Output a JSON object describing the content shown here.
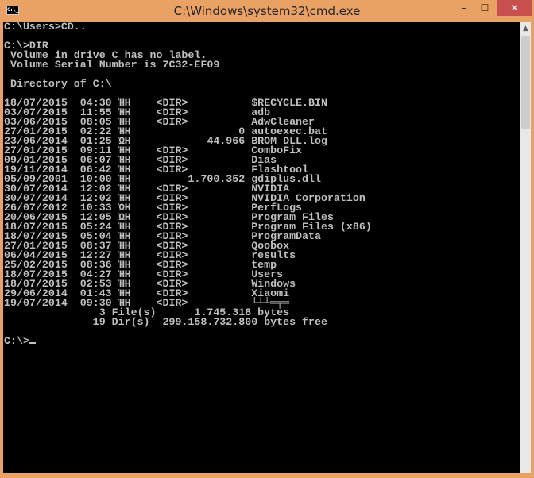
{
  "window": {
    "title": "C:\\Windows\\system32\\cmd.exe",
    "icon": "C:\\_",
    "minimize": "–",
    "maximize": "☐",
    "close": "✕"
  },
  "console": {
    "lines": [
      "C:\\Users>CD..",
      "",
      "C:\\>DIR",
      " Volume in drive C has no label.",
      " Volume Serial Number is 7C32-EF09",
      "",
      " Directory of C:\\",
      "",
      "18/07/2015  04:30 ΉΗ    <DIR>          $RECYCLE.BIN",
      "03/07/2015  11:55 ΉΗ    <DIR>          adb",
      "03/06/2015  08:05 ΉΗ    <DIR>          AdwCleaner",
      "27/01/2015  02:22 ΉΗ                 0 autoexec.bat",
      "23/06/2014  01:25 ΏΗ            44.966 BROM_DLL.log",
      "27/01/2015  09:11 ΉΗ    <DIR>          ComboFix",
      "09/01/2015  06:07 ΉΗ    <DIR>          Dias",
      "19/11/2014  06:42 ΉΗ    <DIR>          Flashtool",
      "05/09/2001  10:00 ΉΗ         1.700.352 gdiplus.dll",
      "30/07/2014  12:02 ΉΗ    <DIR>          NVIDIA",
      "30/07/2014  12:02 ΉΗ    <DIR>          NVIDIA Corporation",
      "26/07/2012  10:33 ΏΗ    <DIR>          PerfLogs",
      "20/06/2015  12:05 ΏΗ    <DIR>          Program Files",
      "18/07/2015  05:24 ΉΗ    <DIR>          Program Files (x86)",
      "18/07/2015  05:04 ΉΗ    <DIR>          ProgramData",
      "27/01/2015  08:37 ΉΗ    <DIR>          Qoobox",
      "06/04/2015  12:27 ΉΗ    <DIR>          results",
      "25/02/2015  08:36 ΉΗ    <DIR>          temp",
      "18/07/2015  04:27 ΉΗ    <DIR>          Users",
      "18/07/2015  02:53 ΉΗ    <DIR>          Windows",
      "29/06/2014  01:43 ΉΗ    <DIR>          Xiaomi",
      "19/07/2014  09:30 ΉΗ    <DIR>          └┴┴═╤═",
      "               3 File(s)      1.745.318 bytes",
      "              19 Dir(s)  299.158.732.800 bytes free",
      ""
    ],
    "prompt": "C:\\>"
  }
}
